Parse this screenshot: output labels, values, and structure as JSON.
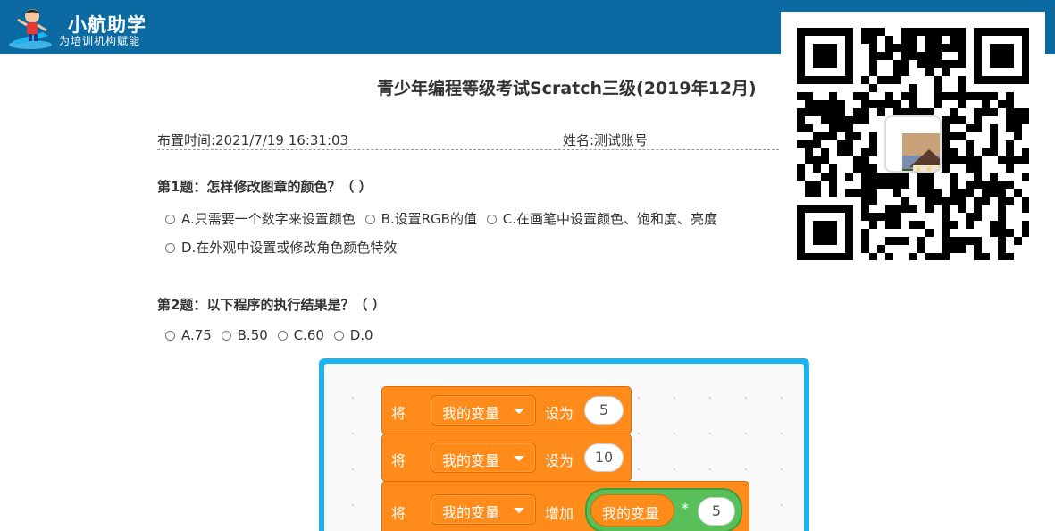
{
  "brand": {
    "title": "小航助学",
    "subtitle": "为培训机构赋能"
  },
  "exam": {
    "title": "青少年编程等级考试Scratch三级(2019年12月)",
    "assigned_time": "布置时间:2021/7/19 16:31:03",
    "student_name": "姓名:测试账号"
  },
  "questions": [
    {
      "title": "第1题：怎样修改图章的颜色？（    ）",
      "options": [
        "A.只需要一个数字来设置颜色",
        "B.设置RGB的值",
        "C.在画笔中设置颜色、饱和度、亮度",
        "D.在外观中设置或修改角色颜色特效"
      ]
    },
    {
      "title": "第2题：以下程序的执行结果是？（    ）",
      "options": [
        "A.75",
        "B.50",
        "C.60",
        "D.0"
      ]
    }
  ],
  "scratch": {
    "blocks": [
      {
        "verb": "将",
        "variable": "我的变量",
        "action": "设为",
        "value": "5"
      },
      {
        "verb": "将",
        "variable": "我的变量",
        "action": "设为",
        "value": "10"
      },
      {
        "verb": "将",
        "variable": "我的变量",
        "action": "增加",
        "operand_variable": "我的变量",
        "operator": "*",
        "value": "5"
      }
    ]
  },
  "colors": {
    "topbar": "#0a6aa1",
    "code_frame": "#1ab4ee",
    "block_orange": "#ff8c1a",
    "operator_green": "#59c059"
  }
}
